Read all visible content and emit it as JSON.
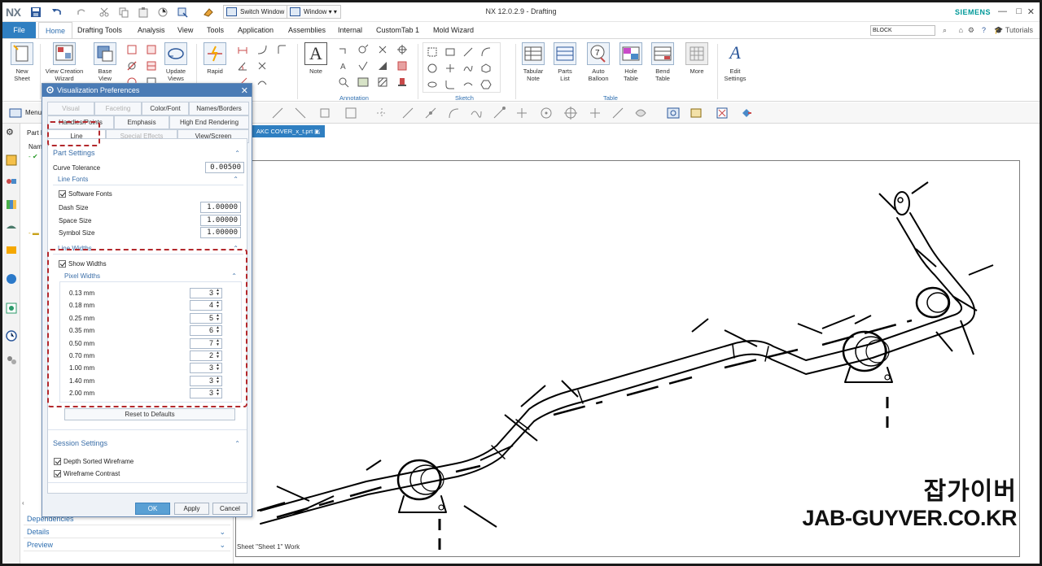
{
  "window": {
    "app_logo": "NX",
    "title": "NX 12.0.2.9 - Drafting",
    "brand": "SIEMENS",
    "switch_window": "Switch Window",
    "window_menu": "Window",
    "controls": [
      "—",
      "□",
      "✕"
    ]
  },
  "menu": {
    "file": "File",
    "tabs": [
      "Home",
      "Drafting Tools",
      "Analysis",
      "View",
      "Tools",
      "Application",
      "Assemblies",
      "Internal",
      "CustomTab 1",
      "Mold Wizard"
    ],
    "active_tab": "Home",
    "search_value": "BLOCK",
    "tutorials": "Tutorials"
  },
  "ribbon": {
    "new_sheet": "New Sheet",
    "view_creation_wizard": "View Creation Wizard",
    "base_view": "Base View",
    "update_views": "Update Views",
    "rapid": "Rapid",
    "note": "Note",
    "annotation_group": "Annotation",
    "sketch_group": "Sketch",
    "tabular_note": "Tabular Note",
    "parts_list": "Parts List",
    "auto_balloon": "Auto Balloon",
    "hole_table": "Hole Table",
    "bend_table": "Bend Table",
    "table_group": "Table",
    "more": "More",
    "edit_settings": "Edit Settings"
  },
  "toolbar2": {
    "menu_label": "Menu"
  },
  "navigator": {
    "tab_label": "Part N",
    "col_name": "Nam",
    "dependencies": "Dependencies",
    "details": "Details",
    "preview": "Preview"
  },
  "graphics": {
    "doc_tab": "AKC COVER_x_t.prt",
    "status": "Sheet \"Sheet 1\" Work",
    "watermark_korean": "잡가이버",
    "watermark_url": "JAB-GUYVER.CO.KR"
  },
  "dialog": {
    "title": "Visualization Preferences",
    "tabs_row1": [
      "Visual",
      "Faceting",
      "Color/Font",
      "Names/Borders"
    ],
    "tabs_row1_disabled": [
      true,
      true,
      false,
      false
    ],
    "tabs_row2": [
      "Handles/Points",
      "Emphasis",
      "High End Rendering"
    ],
    "tabs_row3": [
      "Line",
      "Special Effects",
      "View/Screen"
    ],
    "tabs_row3_disabled": [
      false,
      true,
      false
    ],
    "selected_tab": "Line",
    "part_settings": {
      "header": "Part Settings",
      "curve_tolerance_label": "Curve Tolerance",
      "curve_tolerance_value": "0.00500",
      "line_fonts_header": "Line Fonts",
      "software_fonts_label": "Software Fonts",
      "software_fonts_checked": true,
      "dash_size_label": "Dash Size",
      "dash_size_value": "1.00000",
      "space_size_label": "Space Size",
      "space_size_value": "1.00000",
      "symbol_size_label": "Symbol Size",
      "symbol_size_value": "1.00000",
      "line_widths_header": "Line Widths",
      "show_widths_label": "Show Widths",
      "show_widths_checked": true,
      "pixel_widths_header": "Pixel Widths",
      "pixel_widths": [
        {
          "label": "0.13 mm",
          "value": "3"
        },
        {
          "label": "0.18 mm",
          "value": "4"
        },
        {
          "label": "0.25 mm",
          "value": "5"
        },
        {
          "label": "0.35 mm",
          "value": "6"
        },
        {
          "label": "0.50 mm",
          "value": "7"
        },
        {
          "label": "0.70 mm",
          "value": "2"
        },
        {
          "label": "1.00 mm",
          "value": "3"
        },
        {
          "label": "1.40 mm",
          "value": "3"
        },
        {
          "label": "2.00 mm",
          "value": "3"
        }
      ],
      "reset_label": "Reset to Defaults"
    },
    "session_settings": {
      "header": "Session Settings",
      "depth_sorted_label": "Depth Sorted Wireframe",
      "depth_sorted_checked": true,
      "wireframe_contrast_label": "Wireframe Contrast",
      "wireframe_contrast_checked": true
    },
    "ok": "OK",
    "apply": "Apply",
    "cancel": "Cancel"
  },
  "colors": {
    "accent_blue": "#2f7fc1",
    "dialog_title": "#4a7bb5",
    "highlight_red": "#b3282c",
    "brand_teal": "#009999"
  }
}
